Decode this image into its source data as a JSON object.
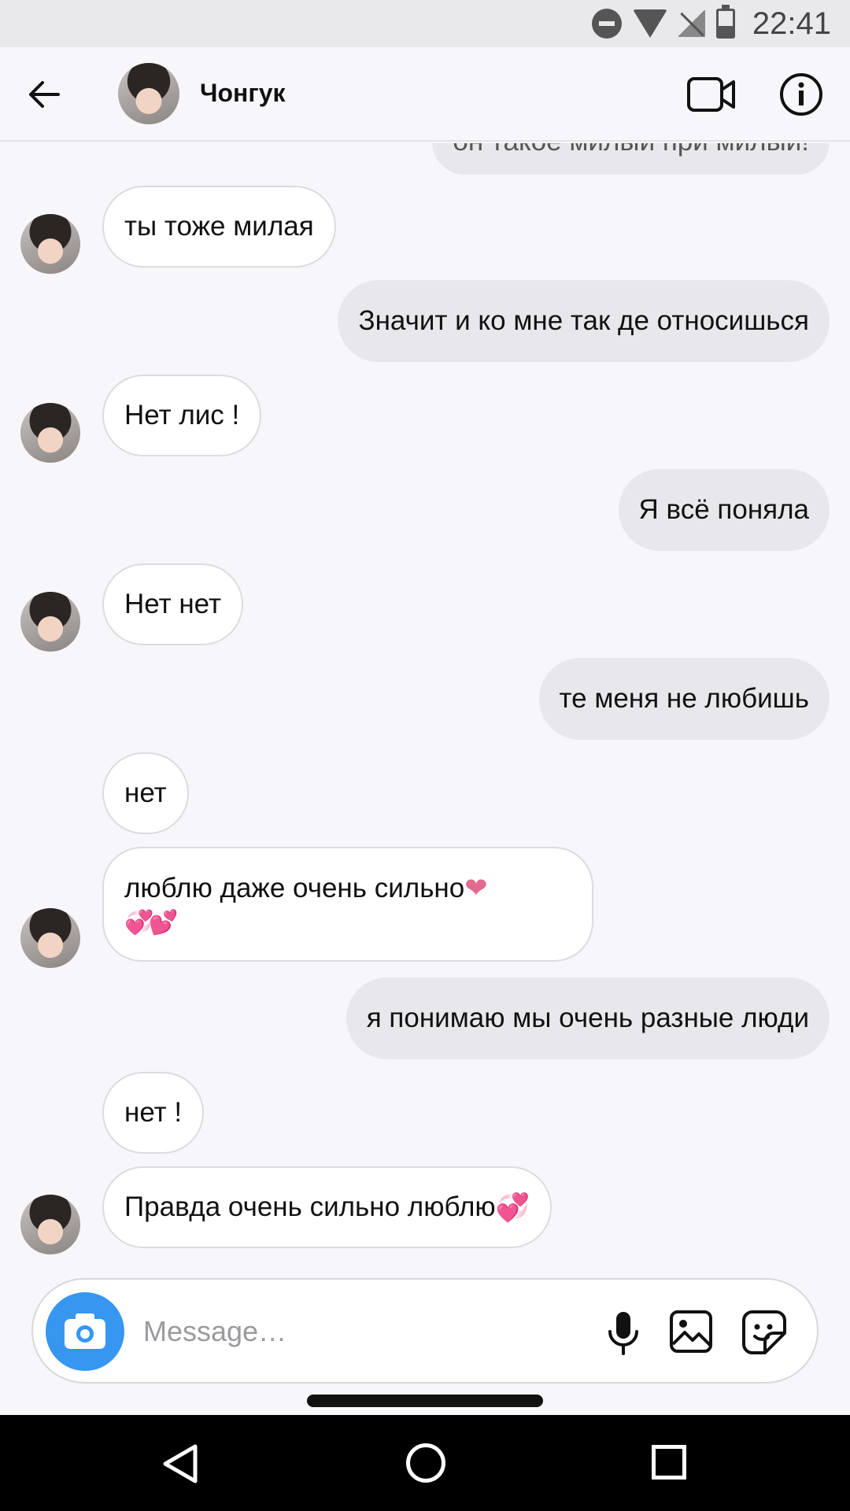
{
  "status_bar": {
    "time": "22:41",
    "icons": [
      "dnd-icon",
      "wifi-icon",
      "no-signal-icon",
      "battery-icon"
    ]
  },
  "header": {
    "title": "Чонгук",
    "back_icon": "arrow-left-icon",
    "video_icon": "video-camera-icon",
    "info_icon": "info-icon"
  },
  "messages": [
    {
      "side": "out",
      "text": "он такое милый при милый!",
      "partial": true
    },
    {
      "side": "in",
      "text": "ты тоже милая"
    },
    {
      "side": "out",
      "text": "Значит и ко мне так де относишься"
    },
    {
      "side": "in",
      "text": "Нет лис !"
    },
    {
      "side": "out",
      "text": "Я всё поняла"
    },
    {
      "side": "in",
      "text": "Нет нет"
    },
    {
      "side": "out",
      "text": "те меня не любишь"
    },
    {
      "side": "in",
      "text": "нет"
    },
    {
      "side": "in",
      "text": "люблю даже очень сильно",
      "emoji": "❤",
      "emoji_line2": "💞💕"
    },
    {
      "side": "out",
      "text": "я понимаю мы очень разные люди"
    },
    {
      "side": "in",
      "text": "нет !"
    },
    {
      "side": "in",
      "text": "Правда очень сильно люблю",
      "emoji": "💞"
    }
  ],
  "composer": {
    "placeholder": "Message…",
    "value": ""
  },
  "colors": {
    "camera_button": "#3797f0",
    "incoming_bubble": "#ffffff",
    "outgoing_bubble": "#e8e7ec",
    "heart": "#e26a8f"
  }
}
